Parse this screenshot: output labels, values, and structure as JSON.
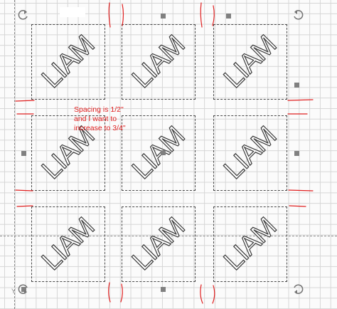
{
  "design": {
    "tiles": [
      {
        "text": "LIAM"
      },
      {
        "text": "LIAM"
      },
      {
        "text": "LIAM"
      },
      {
        "text": "LIAM"
      },
      {
        "text": "LIAM"
      },
      {
        "text": "LIAM"
      },
      {
        "text": "LIAM"
      },
      {
        "text": "LIAM"
      },
      {
        "text": "LIAM"
      }
    ]
  },
  "annotation": {
    "lines": [
      "Spacing is 1/2\"",
      "and I want to",
      "increase to 3/4\""
    ],
    "color": "#e02020"
  },
  "axis": {
    "y_label": "Y"
  },
  "colors": {
    "grid": "#d6d6d6",
    "selection_handle": "#808080",
    "markup": "#e02020"
  },
  "icons": {
    "rotate_handle": "rotate-icon",
    "resize_handle": "resize-handle"
  }
}
